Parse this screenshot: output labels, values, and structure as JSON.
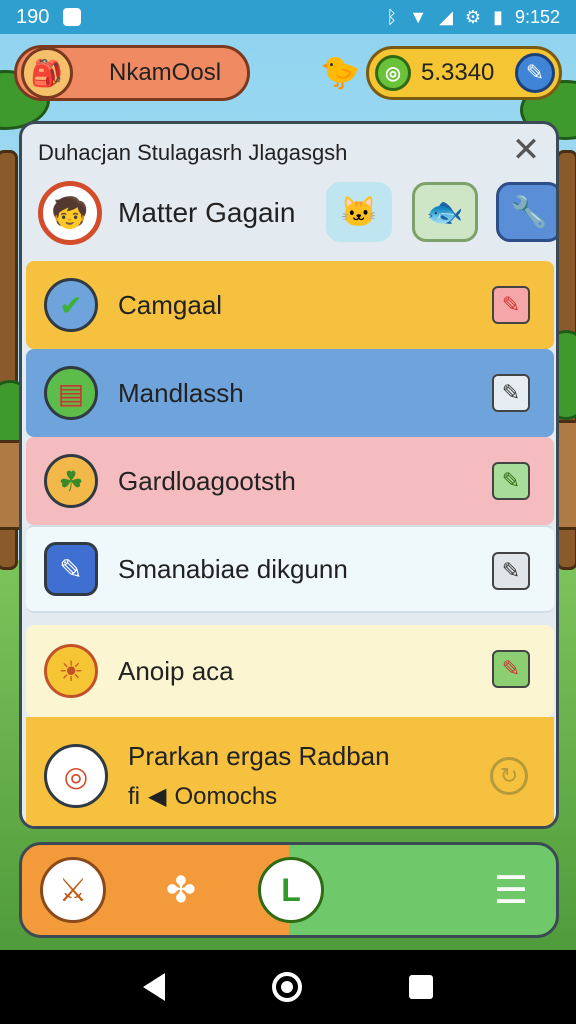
{
  "status_bar": {
    "time_left": "190",
    "time_right": "9:152"
  },
  "hud": {
    "player_name": "NkamOosl",
    "coin_value": "5.3340"
  },
  "panel": {
    "title": "Duhacjan Stulagasrh Jlagasgsh",
    "header_name": "Matter Gagain",
    "rows": [
      {
        "label": "Camgaal"
      },
      {
        "label": "Mandlassh"
      },
      {
        "label": "Gardloagootsth"
      },
      {
        "label": "Smanabiae dikgunn"
      },
      {
        "label": "Anoip aca"
      }
    ],
    "last_row": {
      "title": "Prarkan ergas Radban",
      "subtitle": "Oomochs",
      "subtitle_prefix": "fi"
    }
  },
  "icons": {
    "close": "close-icon",
    "refresh": "refresh-icon",
    "nav": [
      "sword-icon",
      "puzzle-icon",
      "home-icon",
      "menu-icon"
    ]
  },
  "colors": {
    "row_yellow": "#f6c13e",
    "row_blue": "#6fa3dc",
    "row_pink": "#f5bcc0",
    "row_white": "#eff9fc",
    "row_cream": "#fbf5d2",
    "nav_orange": "#f39b3a",
    "nav_green": "#6fc86a"
  }
}
